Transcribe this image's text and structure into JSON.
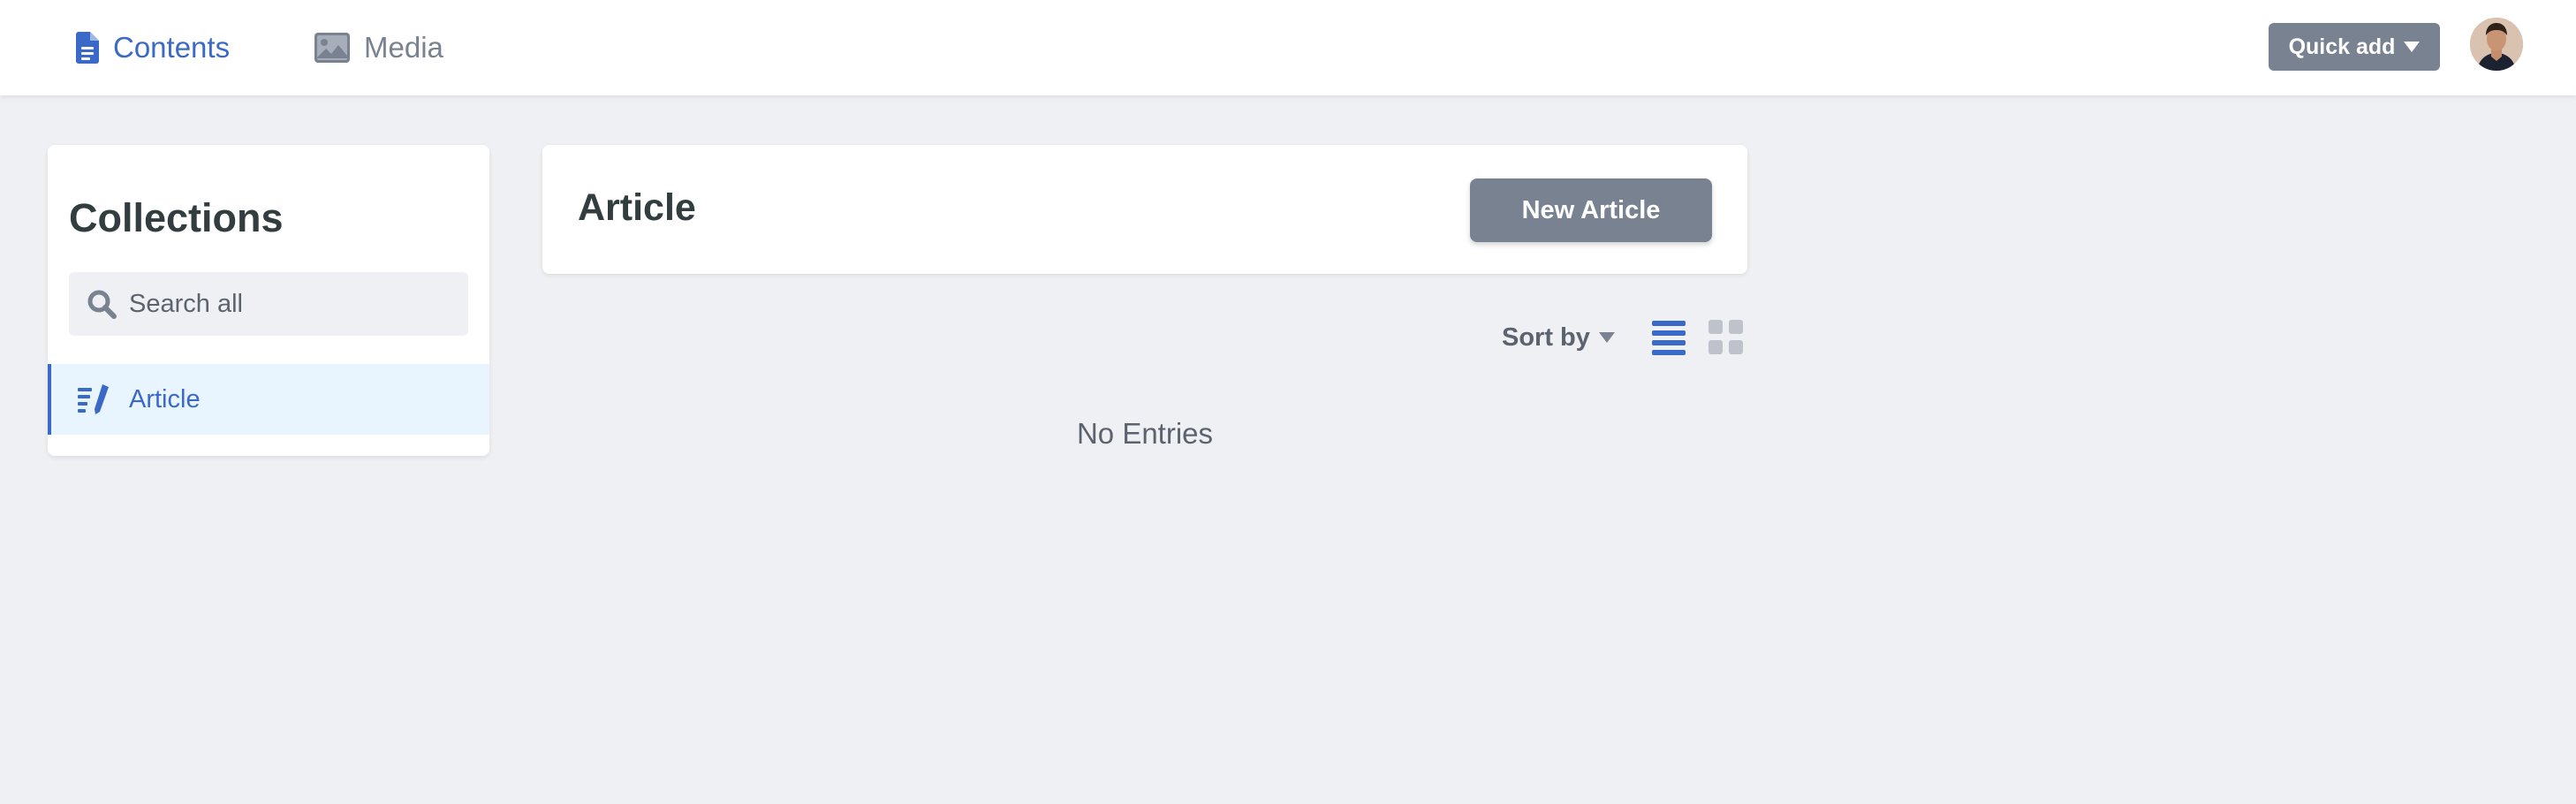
{
  "topbar": {
    "nav": [
      {
        "label": "Contents",
        "icon": "document-icon",
        "active": true
      },
      {
        "label": "Media",
        "icon": "image-icon",
        "active": false
      }
    ],
    "quick_add_label": "Quick add",
    "avatar": "user-avatar"
  },
  "sidebar": {
    "title": "Collections",
    "search_placeholder": "Search all",
    "search_value": "",
    "items": [
      {
        "label": "Article",
        "icon": "write-icon",
        "active": true
      }
    ]
  },
  "main": {
    "title": "Article",
    "new_button_label": "New Article",
    "sort_label": "Sort by",
    "view_modes": [
      "list",
      "grid"
    ],
    "active_view": "list",
    "empty_message": "No Entries"
  },
  "colors": {
    "accent": "#3a69c7",
    "button": "#798291",
    "background": "#eff0f4",
    "active_item_bg": "#e8f5fe",
    "text_dark": "#313d3e",
    "text_muted": "#5d626f"
  }
}
